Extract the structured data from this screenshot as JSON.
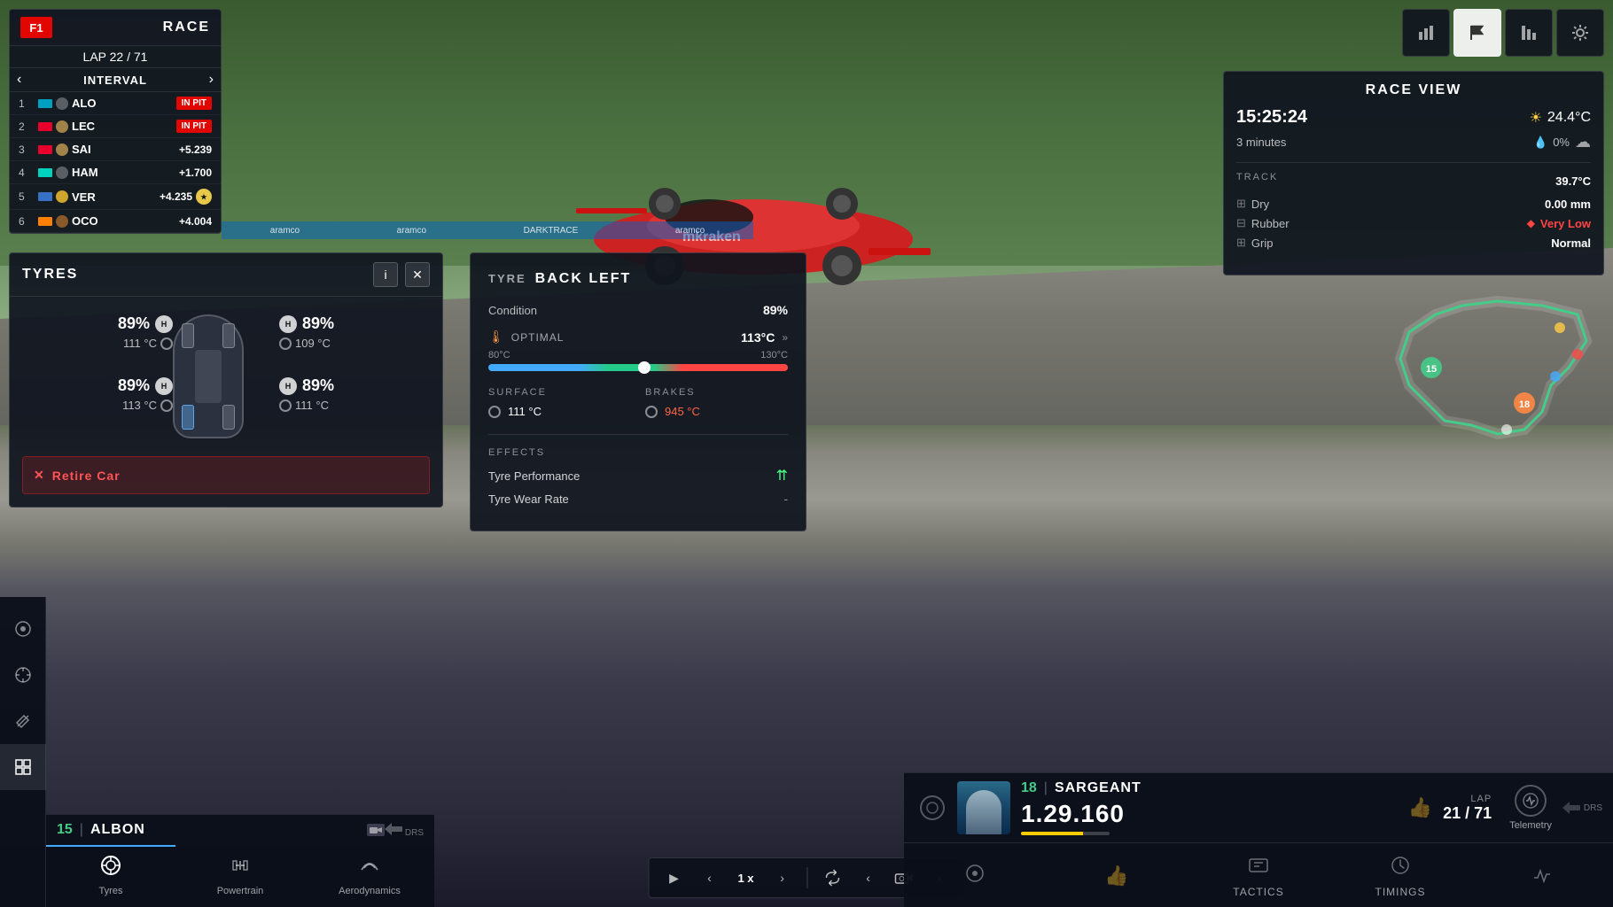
{
  "background": {
    "description": "F1 race track scene with car"
  },
  "race_panel": {
    "f1_logo": "F1",
    "race_label": "RACE",
    "lap_current": "22",
    "lap_total": "71",
    "lap_display": "LAP 22 / 71",
    "nav_prev": "‹",
    "nav_next": "›",
    "interval_label": "INTERVAL",
    "drivers": [
      {
        "pos": "1",
        "code": "ALO",
        "gap": "IN PIT",
        "gap_type": "pit",
        "team_color": "#00a0c0"
      },
      {
        "pos": "2",
        "code": "LEC",
        "gap": "IN PIT",
        "gap_type": "pit",
        "team_color": "#e8002d"
      },
      {
        "pos": "3",
        "code": "SAI",
        "gap": "+5.239",
        "gap_type": "normal",
        "team_color": "#e8002d"
      },
      {
        "pos": "4",
        "code": "HAM",
        "gap": "+1.700",
        "gap_type": "normal",
        "team_color": "#00d2be"
      },
      {
        "pos": "5",
        "code": "VER",
        "gap": "+4.235",
        "gap_type": "normal",
        "team_color": "#3671c6",
        "has_icon": true
      },
      {
        "pos": "6",
        "code": "OCO",
        "gap": "+4.004",
        "gap_type": "normal",
        "team_color": "#ff8000"
      }
    ]
  },
  "tyres_panel": {
    "title": "TYRES",
    "info_btn": "i",
    "close_btn": "✕",
    "wheels": {
      "front_left": {
        "percent": "89%",
        "compound": "H",
        "temp": "111 °C"
      },
      "front_right": {
        "percent": "89%",
        "compound": "H",
        "temp": "109 °C"
      },
      "rear_left": {
        "percent": "89%",
        "compound": "H",
        "temp": "113 °C"
      },
      "rear_right": {
        "percent": "89%",
        "compound": "H",
        "temp": "111 °C"
      }
    },
    "retire_btn": "Retire Car"
  },
  "tyre_detail": {
    "tyre_label": "TYRE",
    "position": "BACK LEFT",
    "condition_label": "Condition",
    "condition_value": "89%",
    "optimal_label": "OPTIMAL",
    "optimal_temp": "113°C",
    "temp_arrows": "»",
    "temp_min": "80°C",
    "temp_max": "130°C",
    "temp_indicator_pct": "52",
    "surface_title": "SURFACE",
    "brakes_title": "BRAKES",
    "surface_temp": "111 °C",
    "brakes_temp": "945 °C",
    "effects_title": "EFFECTS",
    "tyre_performance_label": "Tyre Performance",
    "tyre_performance_val": "⇈",
    "tyre_wear_label": "Tyre Wear Rate",
    "tyre_wear_val": "-"
  },
  "race_view": {
    "title": "RACE VIEW",
    "time": "15:25:24",
    "temp": "24.4°C",
    "minutes_label": "3 minutes",
    "rain_pct": "0%",
    "track_label": "TRACK",
    "track_temp": "39.7°C",
    "dry_label": "Dry",
    "dry_val": "0.00 mm",
    "rubber_label": "Rubber",
    "rubber_val": "Very Low",
    "grip_label": "Grip",
    "grip_val": "Normal"
  },
  "driver_albon": {
    "number": "15",
    "divider": "|",
    "name": "ALBON",
    "drs_label": "DRS"
  },
  "bottom_tabs_left": [
    {
      "icon": "⚙",
      "label": ""
    },
    {
      "icon": "◉",
      "label": ""
    },
    {
      "icon": "⚡",
      "label": ""
    },
    {
      "icon": "🔧",
      "label": ""
    },
    {
      "icon": "📊",
      "label": ""
    }
  ],
  "bottom_tabs": [
    {
      "icon": "🔘",
      "label": "Tyres",
      "active": true
    },
    {
      "icon": "⚙",
      "label": "Powertrain",
      "active": false
    },
    {
      "icon": "🌬",
      "label": "Aerodynamics",
      "active": false
    }
  ],
  "bottom_center": {
    "play_btn": "▶",
    "prev_btn": "‹",
    "speed": "1 x",
    "next_btn": "›",
    "loop_btn": "↻",
    "cam_prev": "‹",
    "cam_btn": "📷",
    "cam_next": "›"
  },
  "driver_sargeant": {
    "number": "18",
    "divider": "|",
    "name": "SARGEANT",
    "thumb_icon": "👍",
    "lap_label": "LAP",
    "lap_current": "21",
    "lap_total": "71",
    "lap_display": "21 / 71",
    "lap_time": "1.29.160",
    "telemetry_label": "Telemetry",
    "drs_label": "DRS"
  },
  "sargeant_tabs": [
    {
      "icon": "⚙",
      "label": ""
    },
    {
      "icon": "👍",
      "label": ""
    },
    {
      "icon": "TACTICS",
      "label": "TACTICS"
    },
    {
      "icon": "TIMINGS",
      "label": "TIMINGS"
    },
    {
      "icon": "◉",
      "label": "Telemetry"
    }
  ],
  "nav_icons": {
    "chart_bar": "📊",
    "flag": "🏁",
    "bar_chart": "📈",
    "gear": "⚙"
  },
  "track_map": {
    "marker_15": "15",
    "marker_18": "18"
  }
}
